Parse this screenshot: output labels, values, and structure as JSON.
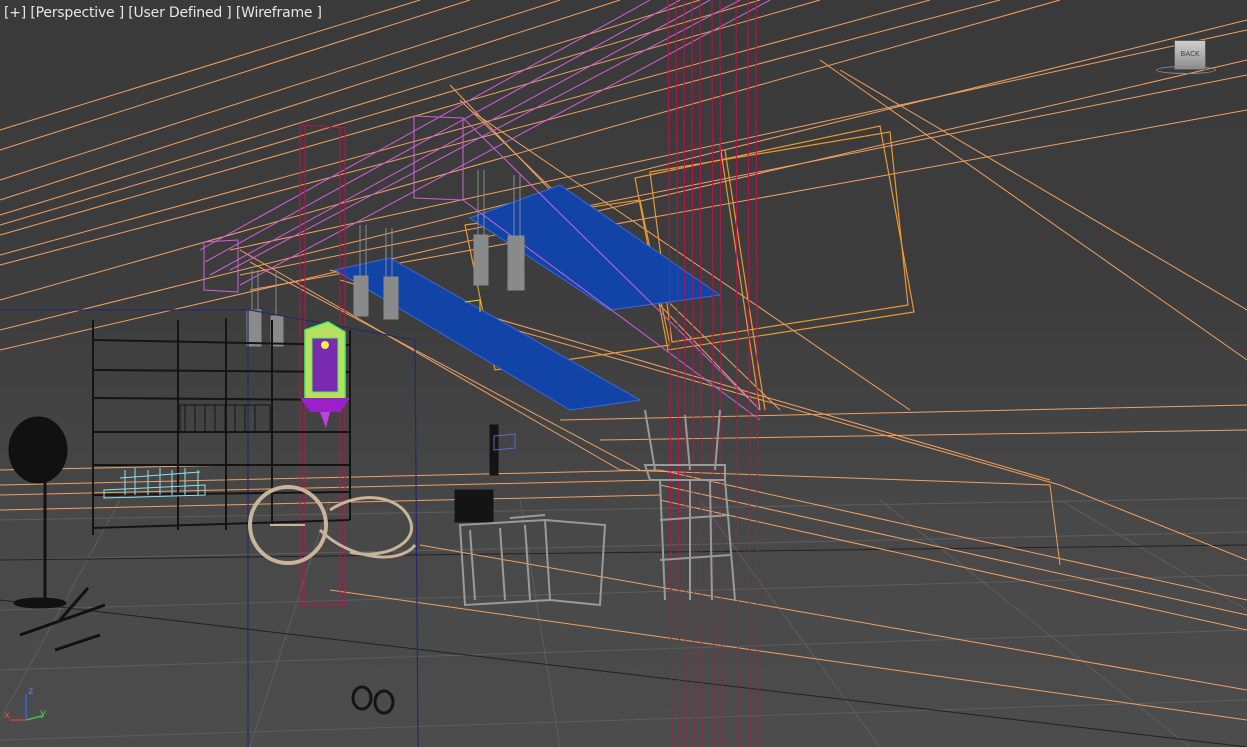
{
  "viewport": {
    "label": {
      "plus": "[+]",
      "view": "[Perspective ]",
      "camera": "[User Defined ]",
      "shading": "[Wireframe ]"
    },
    "viewcube_text": "BACK",
    "axis_labels": {
      "x": "x",
      "y": "y",
      "z": "z"
    }
  },
  "colors": {
    "background": "#444444",
    "grid": "#5e5e5e",
    "roof_lines": "#f0a060",
    "magenta_lines": "#d060d8",
    "crimson_columns": "#b8144a",
    "window_glass": "#1244a8",
    "shelf": "#141414",
    "chair": "#9a9a9a",
    "wheel": "#c8b49a",
    "lamp_green": "#4cf060",
    "lamp_purple": "#9a20c8",
    "selection_box": "#28286e",
    "books": "#8fe0f0"
  }
}
